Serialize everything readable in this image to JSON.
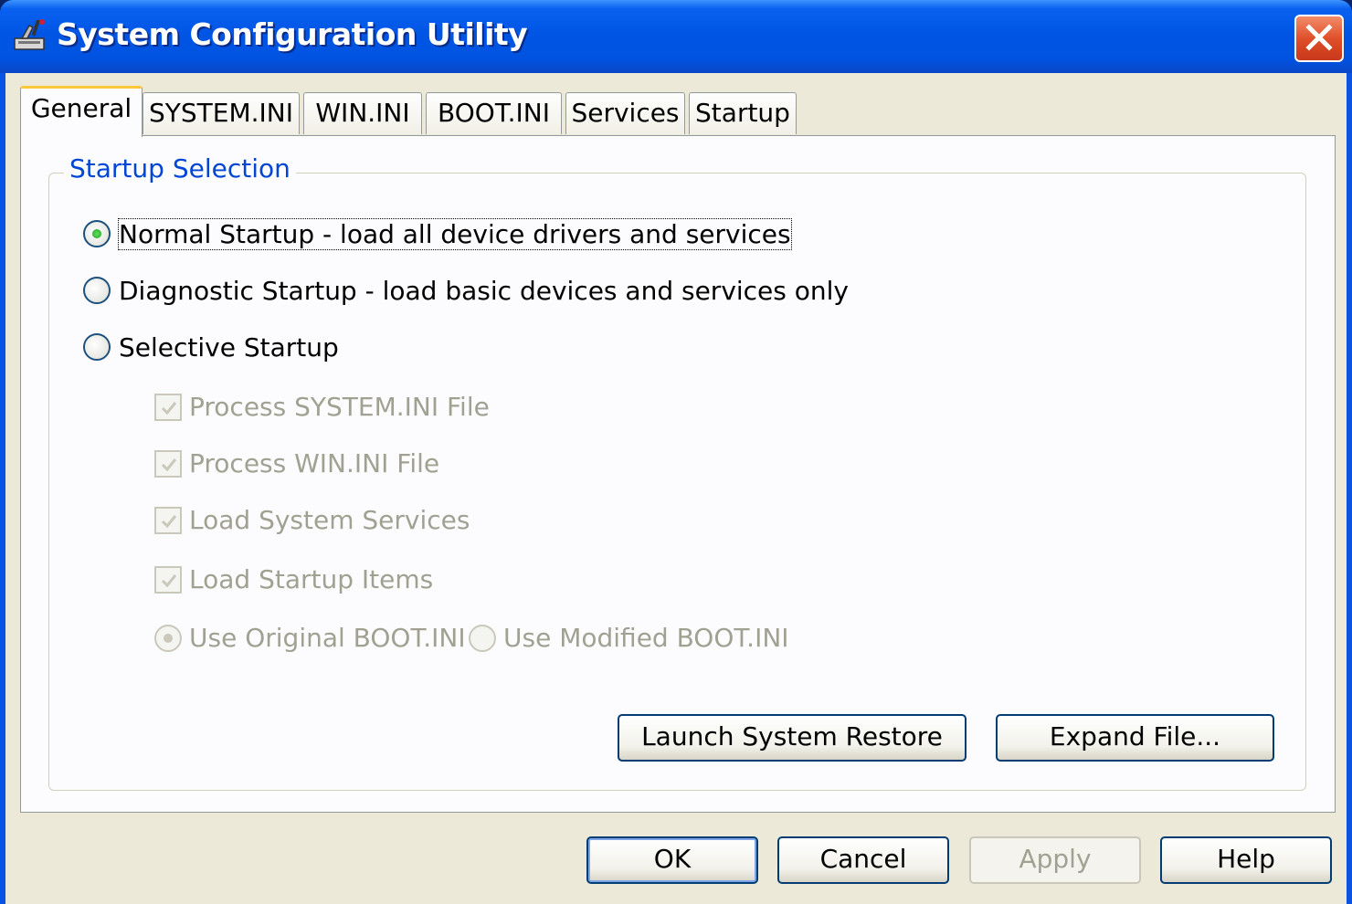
{
  "window": {
    "title": "System Configuration Utility"
  },
  "tabs": [
    "General",
    "SYSTEM.INI",
    "WIN.INI",
    "BOOT.INI",
    "Services",
    "Startup"
  ],
  "active_tab": "General",
  "startup_selection": {
    "group_title": "Startup Selection",
    "normal": {
      "label": "Normal Startup - load all device drivers and services",
      "selected": true
    },
    "diagnostic": {
      "label": "Diagnostic Startup - load basic devices and services only",
      "selected": false
    },
    "selective": {
      "label": "Selective Startup",
      "selected": false
    }
  },
  "selective_options": {
    "process_system_ini": {
      "label": "Process SYSTEM.INI File",
      "checked": true,
      "enabled": false
    },
    "process_win_ini": {
      "label": "Process WIN.INI File",
      "checked": true,
      "enabled": false
    },
    "load_system_services": {
      "label": "Load System Services",
      "checked": true,
      "enabled": false
    },
    "load_startup_items": {
      "label": "Load Startup Items",
      "checked": true,
      "enabled": false
    },
    "use_original_boot_ini": {
      "label": "Use Original BOOT.INI",
      "selected": true,
      "enabled": false
    },
    "use_modified_boot_ini": {
      "label": "Use Modified BOOT.INI",
      "selected": false,
      "enabled": false
    }
  },
  "panel_buttons": {
    "launch_system_restore": "Launch System Restore",
    "expand_file": "Expand File..."
  },
  "dialog_buttons": {
    "ok": "OK",
    "cancel": "Cancel",
    "apply": "Apply",
    "help": "Help"
  },
  "colors": {
    "title_bar": "#0055e5",
    "group_title": "#0046d5",
    "disabled_text": "#a1a192",
    "radio_dot": "#21a121",
    "close_button": "#e0502a"
  }
}
